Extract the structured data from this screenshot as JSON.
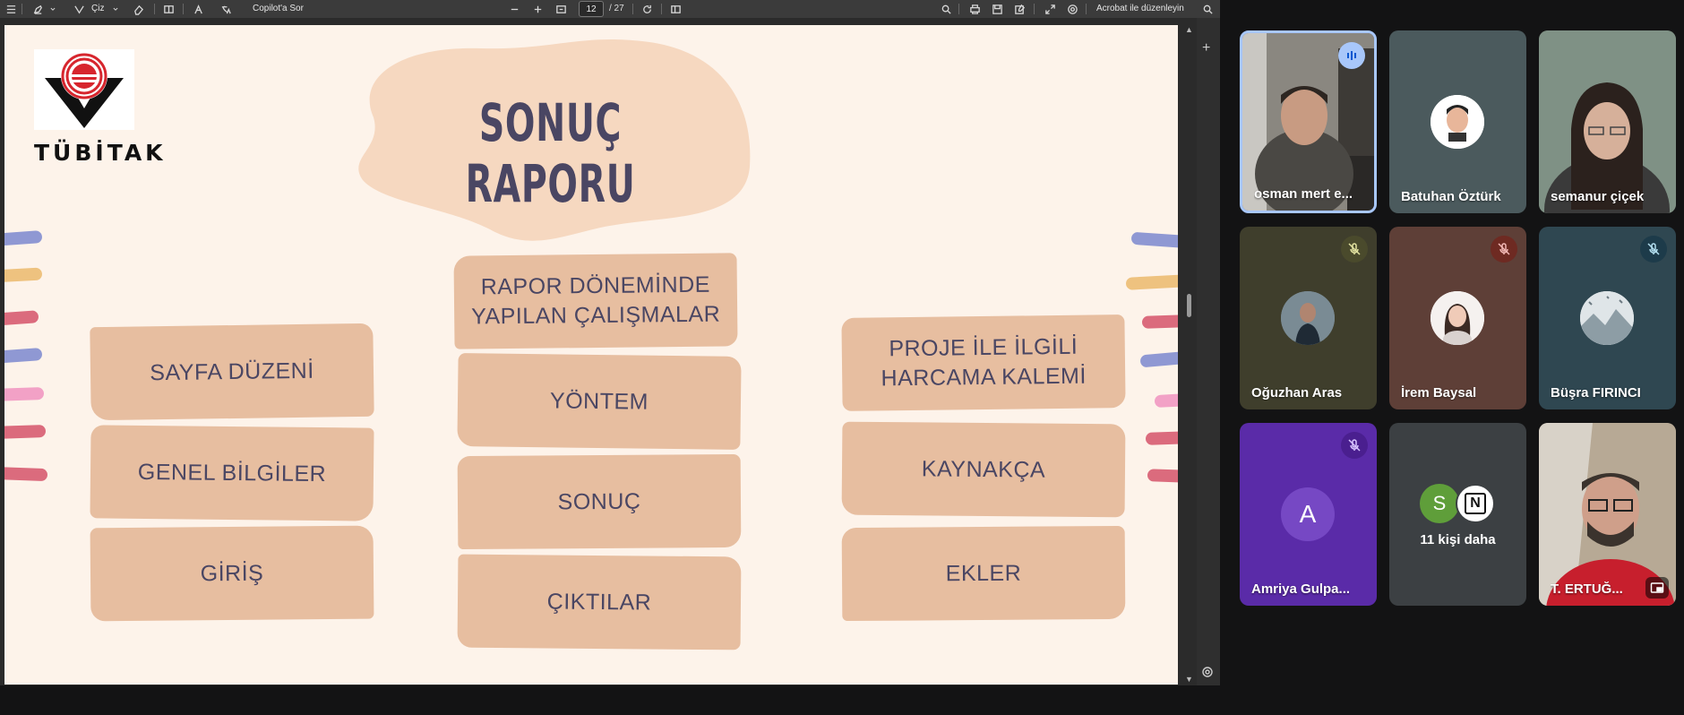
{
  "pdf_viewer": {
    "toolbar": {
      "draw_label": "Çiz",
      "copilot_label": "Copilot'a Sor",
      "page_current": "12",
      "page_total": "/ 27",
      "acrobat_label": "Acrobat ile düzenleyin"
    },
    "slide": {
      "logo_text": "TÜBİTAK",
      "title": "SONUÇ RAPORU",
      "cards": {
        "sayfa_duzeni": "SAYFA DÜZENİ",
        "genel_bilgiler": "GENEL BİLGİLER",
        "giris": "GİRİŞ",
        "rapor_doneminde_1": "RAPOR DÖNEMİNDE",
        "rapor_doneminde_2": "YAPILAN ÇALIŞMALAR",
        "yontem": "YÖNTEM",
        "sonuc": "SONUÇ",
        "ciktilar": "ÇIKTILAR",
        "proje_1": "PROJE İLE İLGİLİ",
        "proje_2": "HARCAMA KALEMİ",
        "kaynakca": "KAYNAKÇA",
        "ekler": "EKLER"
      }
    }
  },
  "meeting": {
    "participants": [
      {
        "name": "osman mert e...",
        "status": "speaking",
        "icon": "audio-wave-icon"
      },
      {
        "name": "Batuhan Öztürk",
        "status": "no-badge",
        "icon": ""
      },
      {
        "name": "semanur çiçek",
        "status": "no-badge",
        "icon": ""
      },
      {
        "name": "Oğuzhan Aras",
        "status": "muted",
        "icon": "mic-off-icon"
      },
      {
        "name": "İrem Baysal",
        "status": "muted",
        "icon": "mic-off-icon"
      },
      {
        "name": "Büşra FIRINCI",
        "status": "muted",
        "icon": "mic-off-icon"
      },
      {
        "name": "Amriya Gulpa...",
        "status": "muted",
        "icon": "mic-off-icon",
        "initial": "A"
      },
      {
        "name": "T. ERTUĞ...",
        "status": "pinned",
        "icon": "picture-in-picture-icon"
      }
    ],
    "more": {
      "initial_1": "S",
      "initial_2": "N",
      "label": "11 kişi daha"
    }
  },
  "colors": {
    "slide_bg": "#fdf3ea",
    "card": "#e7bea0",
    "title": "#4a4663",
    "tile_bg": "#3c4043",
    "app_bg": "#131314"
  }
}
